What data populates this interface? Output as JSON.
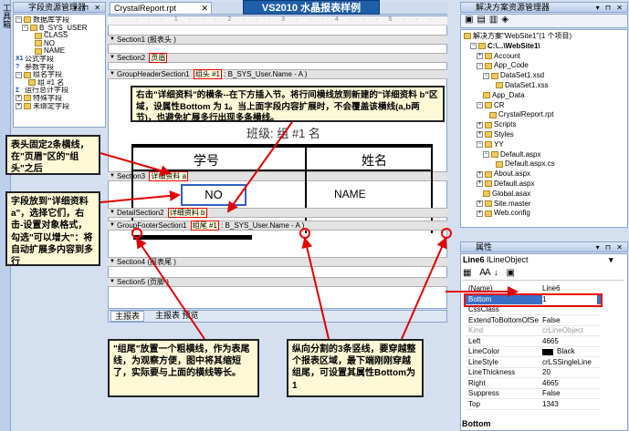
{
  "left_toolbox": {
    "label": "工具箱"
  },
  "field_explorer": {
    "title": "字段资源管理器",
    "controls": "▾ ⊓ ✕",
    "items": [
      {
        "label": "数据库字段",
        "indent": 0,
        "expand": "−"
      },
      {
        "label": "B_SYS_USER",
        "indent": 1,
        "expand": "−"
      },
      {
        "label": "CLASS",
        "indent": 3
      },
      {
        "label": "NO",
        "indent": 3
      },
      {
        "label": "NAME",
        "indent": 3
      },
      {
        "label": "公式字段",
        "indent": 0,
        "icon": "X1"
      },
      {
        "label": "参数字段",
        "indent": 0,
        "icon": "?"
      },
      {
        "label": "组名字段",
        "indent": 0,
        "expand": "−"
      },
      {
        "label": "组 #1 名",
        "indent": 2
      },
      {
        "label": "运行总计字段",
        "indent": 0,
        "icon": "Σ"
      },
      {
        "label": "特殊字段",
        "indent": 0,
        "expand": "+"
      },
      {
        "label": "未绑定字段",
        "indent": 0,
        "expand": "+"
      }
    ]
  },
  "doc_tabs": {
    "active": "CrystalReport.rpt",
    "close": "✕",
    "title_banner": "VS2010 水晶报表样例"
  },
  "sections": {
    "s1": "Section1 (报表头 )",
    "s2": "Section2",
    "s2_tag": "页眉",
    "gh": "GroupHeaderSection1",
    "gh_tag": "组头 #1",
    "gh_rest": ": B_SYS_User.Name - A )",
    "s3": "Section3",
    "s3_tag": "详细资料 a",
    "d2": "DetailSection2",
    "d2_tag": "详细资料 b",
    "gf": "GroupFooterSection1",
    "gf_tag": "组尾 #1",
    "gf_rest": ": B_SYS_User.Name - A )",
    "s4": "Section4 (报表尾 )",
    "s5": "Section5 (页脚 )"
  },
  "report": {
    "group_label": "班级: 组 #1 名",
    "col_no": "学号",
    "col_name": "姓名",
    "field_no": "NO",
    "field_name": "NAME"
  },
  "bottom_tabs": {
    "main": "主报表",
    "preview": "主报表 预览"
  },
  "callouts": {
    "top": "右击\"详细资料\"的横条--在下方插入节。将行间横线放到新建的\"详细资料 b\"区域，设属性Bottom 为 1。当上面字段内容扩展时，不会覆盖该横线(a,b两节)，也避免扩展多行出现多条横线。",
    "left1": "表头固定2条横线，在\"页眉\"区的\"组头\"之后",
    "left2": "字段放到\"详细资料 a\"，选择它们，右击-设置对象格式，勾选\"可以增大\"：将自动扩展多内容到多行",
    "bottom_left": "\"组尾\"放置一个粗横线，作为表尾线，为观察方便，图中将其缩短了，实际要与上面的横线等长。",
    "bottom_right": "纵向分割的3条竖线，要穿越整个报表区域，最下端刚刚穿越组尾，可设置其属性Bottom为 1"
  },
  "solution_explorer": {
    "title": "解决方案资源管理器",
    "controls": "▾ ⊓ ✕",
    "items": [
      {
        "label": "解决方案\"WebSite1\"(1 个项目)",
        "indent": 0
      },
      {
        "label": "C:\\...\\WebSite1\\",
        "indent": 1,
        "expand": "−",
        "bold": true
      },
      {
        "label": "Account",
        "indent": 2,
        "expand": "+"
      },
      {
        "label": "App_Code",
        "indent": 2,
        "expand": "−"
      },
      {
        "label": "DataSet1.xsd",
        "indent": 3,
        "expand": "−"
      },
      {
        "label": "DataSet1.xss",
        "indent": 5
      },
      {
        "label": "App_Data",
        "indent": 3
      },
      {
        "label": "CR",
        "indent": 2,
        "expand": "−"
      },
      {
        "label": "CrystalReport.rpt",
        "indent": 4
      },
      {
        "label": "Scripts",
        "indent": 2,
        "expand": "+"
      },
      {
        "label": "Styles",
        "indent": 2,
        "expand": "+"
      },
      {
        "label": "YY",
        "indent": 2,
        "expand": "−"
      },
      {
        "label": "Default.aspx",
        "indent": 3,
        "expand": "−"
      },
      {
        "label": "Default.aspx.cs",
        "indent": 5
      },
      {
        "label": "About.aspx",
        "indent": 2,
        "expand": "+"
      },
      {
        "label": "Default.aspx",
        "indent": 2,
        "expand": "+"
      },
      {
        "label": "Global.asax",
        "indent": 3
      },
      {
        "label": "Site.master",
        "indent": 2,
        "expand": "+"
      },
      {
        "label": "Web.config",
        "indent": 2,
        "expand": "+"
      }
    ]
  },
  "properties": {
    "title": "属性",
    "controls": "▾ ⊓ ✕",
    "object": "Line6",
    "object_type": "ILineObject",
    "rows": [
      {
        "name": "(Name)",
        "value": "Line6"
      },
      {
        "name": "Bottom",
        "value": "1",
        "selected": true
      },
      {
        "name": "CssClass",
        "value": ""
      },
      {
        "name": "ExtendToBottomOfSe",
        "value": "False"
      },
      {
        "name": "Kind",
        "value": "crLineObject",
        "grey": true
      },
      {
        "name": "Left",
        "value": "4665"
      },
      {
        "name": "LineColor",
        "value": "Black",
        "swatch": "#000000"
      },
      {
        "name": "LineStyle",
        "value": "crLSSingleLine"
      },
      {
        "name": "LineThickness",
        "value": "20"
      },
      {
        "name": "Right",
        "value": "4665"
      },
      {
        "name": "Suppress",
        "value": "False"
      },
      {
        "name": "Top",
        "value": "1343"
      }
    ],
    "footer": "Bottom"
  },
  "colors": {
    "accent": "#ff0000",
    "callout_bg": "#fdf9d6",
    "banner_bg": "#1f5ea8"
  }
}
